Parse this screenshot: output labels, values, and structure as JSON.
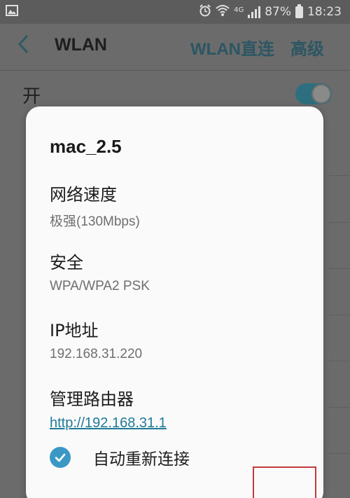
{
  "status_bar": {
    "network_type": "4G",
    "battery_percent": "87%",
    "time": "18:23",
    "icons": [
      "image-icon",
      "alarm-icon",
      "wifi-icon",
      "signal-icon",
      "battery-icon"
    ]
  },
  "app_bar": {
    "back_icon": "chevron-left-icon",
    "title": "WLAN",
    "direct_label": "WLAN直连",
    "advanced_label": "高级"
  },
  "switch_row": {
    "label": "开",
    "toggle_on": true
  },
  "dialog": {
    "network_name": "mac_2.5",
    "speed": {
      "label": "网络速度",
      "value": "极强(130Mbps)"
    },
    "security": {
      "label": "安全",
      "value": "WPA/WPA2 PSK"
    },
    "ip": {
      "label": "IP地址",
      "value": "192.168.31.220"
    },
    "router": {
      "label": "管理路由器",
      "link": "http://192.168.31.1"
    },
    "auto_reconnect": {
      "label": "自动重新连接",
      "checked": true
    }
  },
  "colors": {
    "accent": "#2c5663",
    "link": "#1f7a98",
    "checkbox": "#3b98c4",
    "highlight": "#c43a3a"
  }
}
